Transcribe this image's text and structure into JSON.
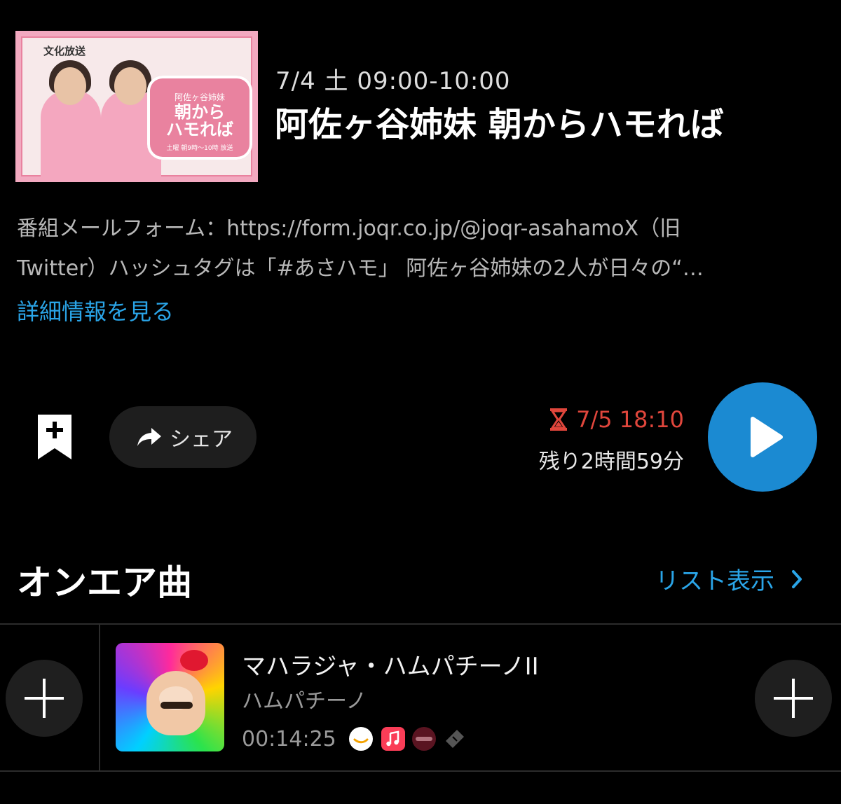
{
  "program": {
    "air_time": "7/4 土 09:00-10:00",
    "title": "阿佐ヶ谷姉妹 朝からハモれば",
    "description_lines": [
      "番組メールフォーム：https://form.joqr.co.jp/@joqr-asahamoX（旧",
      "Twitter）ハッシュタグは「#あさハモ」 阿佐ヶ谷姉妹の2人が日々の“…"
    ],
    "more_link": "詳細情報を見る",
    "thumbnail": {
      "station_logo": "文化放送",
      "badge_small": "阿佐ヶ谷姉妹",
      "badge_title_1": "朝から",
      "badge_title_2": "ハモれば",
      "badge_sub": "土曜 朝9時〜10時 放送"
    }
  },
  "actions": {
    "share_label": "シェア",
    "expire_date": "7/5 18:10",
    "remaining": "残り2時間59分"
  },
  "onair": {
    "heading": "オンエア曲",
    "list_link": "リスト表示",
    "songs": [
      {
        "title": "マハラジャ・ハムパチーノII",
        "artist": "ハムパチーノ",
        "time": "00:14:25"
      }
    ]
  },
  "icons": [
    "bookmark-add-icon",
    "share-arrow-icon",
    "hourglass-icon",
    "play-icon",
    "chevron-right-icon",
    "plus-icon",
    "amazon-music-icon",
    "apple-music-icon",
    "recochoku-icon",
    "ticket-icon"
  ],
  "colors": {
    "accent_blue": "#1b8ad2",
    "link_blue": "#2aa5e8",
    "expire_red": "#e0463c",
    "background": "#000000"
  }
}
